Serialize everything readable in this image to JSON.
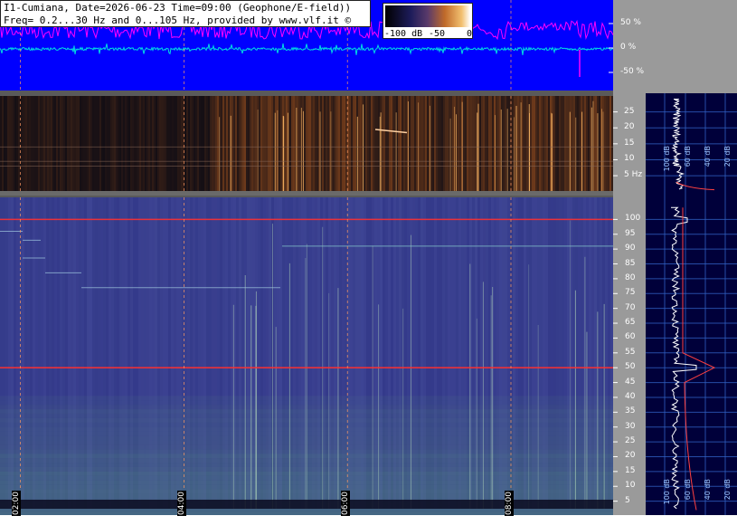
{
  "header": {
    "line1": "I1-Cumiana, Date=2026-06-23 Time=09:00 (Geophone/E-field))",
    "line2": "Freq= 0.2...30 Hz and 0...105 Hz, provided by www.vlf.it ©"
  },
  "colorbar": {
    "ticks": [
      "-100 dB",
      "-50",
      "0"
    ],
    "colors": [
      "#000000",
      "#1d1c5a",
      "#c06a2a",
      "#ffffff"
    ]
  },
  "colors": {
    "waveform_bg": "#0000ff",
    "waveform_magenta": "#ff00ff",
    "waveform_cyan": "#00e0e0",
    "axis_bg_gray": "#9a9a9a",
    "side_bg": "#00003a",
    "hum_line": "#ff3030",
    "grid_line": "#ff9a60"
  },
  "chart_data": [
    {
      "type": "line",
      "name": "waveform",
      "ytick_labels": [
        "50 %",
        "0 %",
        "-50 %"
      ],
      "yticks": [
        50,
        0,
        -50
      ],
      "ylim": [
        -100,
        100
      ]
    },
    {
      "type": "heatmap",
      "name": "low-frequency spectrogram",
      "ytick_labels": [
        "25",
        "20",
        "15",
        "10",
        "5 Hz"
      ],
      "yticks": [
        25,
        20,
        15,
        10,
        5
      ],
      "ylim": [
        0.2,
        30
      ],
      "side_spectrum_labels": [
        "100 dB",
        "60 dB",
        "40 dB",
        "20 dB"
      ]
    },
    {
      "type": "heatmap",
      "name": "spectrogram 0-105 Hz",
      "ytick_labels": [
        "100",
        "95",
        "90",
        "85",
        "80",
        "75",
        "70",
        "65",
        "60",
        "55",
        "50",
        "45",
        "40",
        "35",
        "30",
        "25",
        "20",
        "15",
        "10",
        "5"
      ],
      "yticks": [
        100,
        95,
        90,
        85,
        80,
        75,
        70,
        65,
        60,
        55,
        50,
        45,
        40,
        35,
        30,
        25,
        20,
        15,
        10,
        5
      ],
      "ylim": [
        0,
        105
      ],
      "x_tick_labels": [
        "02:00",
        "04:00",
        "06:00",
        "08:00"
      ],
      "x_ticks_hours": [
        2,
        4,
        6,
        8
      ],
      "xlim_hours": [
        1.5,
        9.0
      ],
      "highlight_lines_hz": [
        100,
        50
      ],
      "side_spectrum_labels": [
        "100 dB",
        "60 dB",
        "40 dB",
        "20 dB"
      ]
    }
  ]
}
